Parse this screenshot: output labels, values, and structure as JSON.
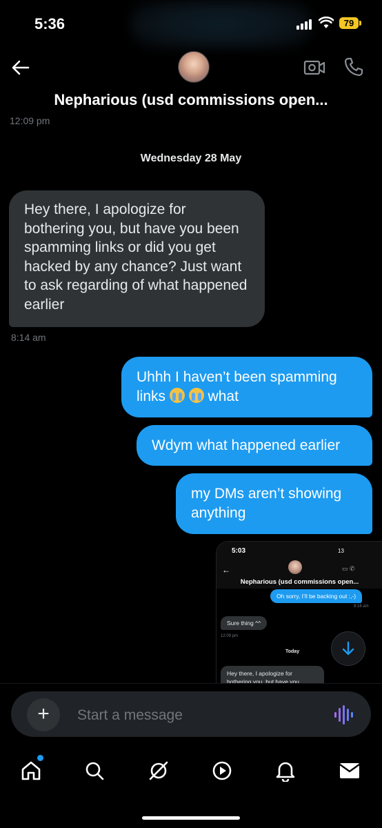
{
  "status_bar": {
    "time": "5:36",
    "battery": "79"
  },
  "header": {
    "title": "Nepharious (usd commissions open...",
    "avatar_icon": "avatar",
    "video_icon": "video-camera-icon",
    "call_icon": "phone-icon"
  },
  "messages": {
    "top_timestamp": "12:09 pm",
    "date_separator": "Wednesday 28 May",
    "incoming": {
      "text": "Hey there, I apologize for bothering you, but have you been spamming links or did you get hacked by any chance? Just want to ask regarding of what happened earlier",
      "timestamp": "8:14 am"
    },
    "outgoing": [
      {
        "text_before": "Uhhh I haven’t been spamming links",
        "text_after": "what"
      },
      {
        "text": "Wdym what happened earlier"
      },
      {
        "text": "my DMs aren’t showing anything"
      }
    ]
  },
  "embedded_screenshot": {
    "time": "5:03",
    "status": "13",
    "title": "Nepharious (usd commissions open...",
    "outgoing": "Oh sorry, I’ll be backing out :,-)",
    "outgoing_time": "9:16 am",
    "incoming": "Sure thing ^^",
    "incoming_time": "12:09 pm",
    "date_separator": "Today",
    "incoming_2": "Hey there, I apologize for bothering you, but have you"
  },
  "composer": {
    "placeholder": "Start a message"
  },
  "colors": {
    "accent": "#1d9bf0",
    "incoming_bubble": "#2f3336",
    "background": "#000000"
  }
}
